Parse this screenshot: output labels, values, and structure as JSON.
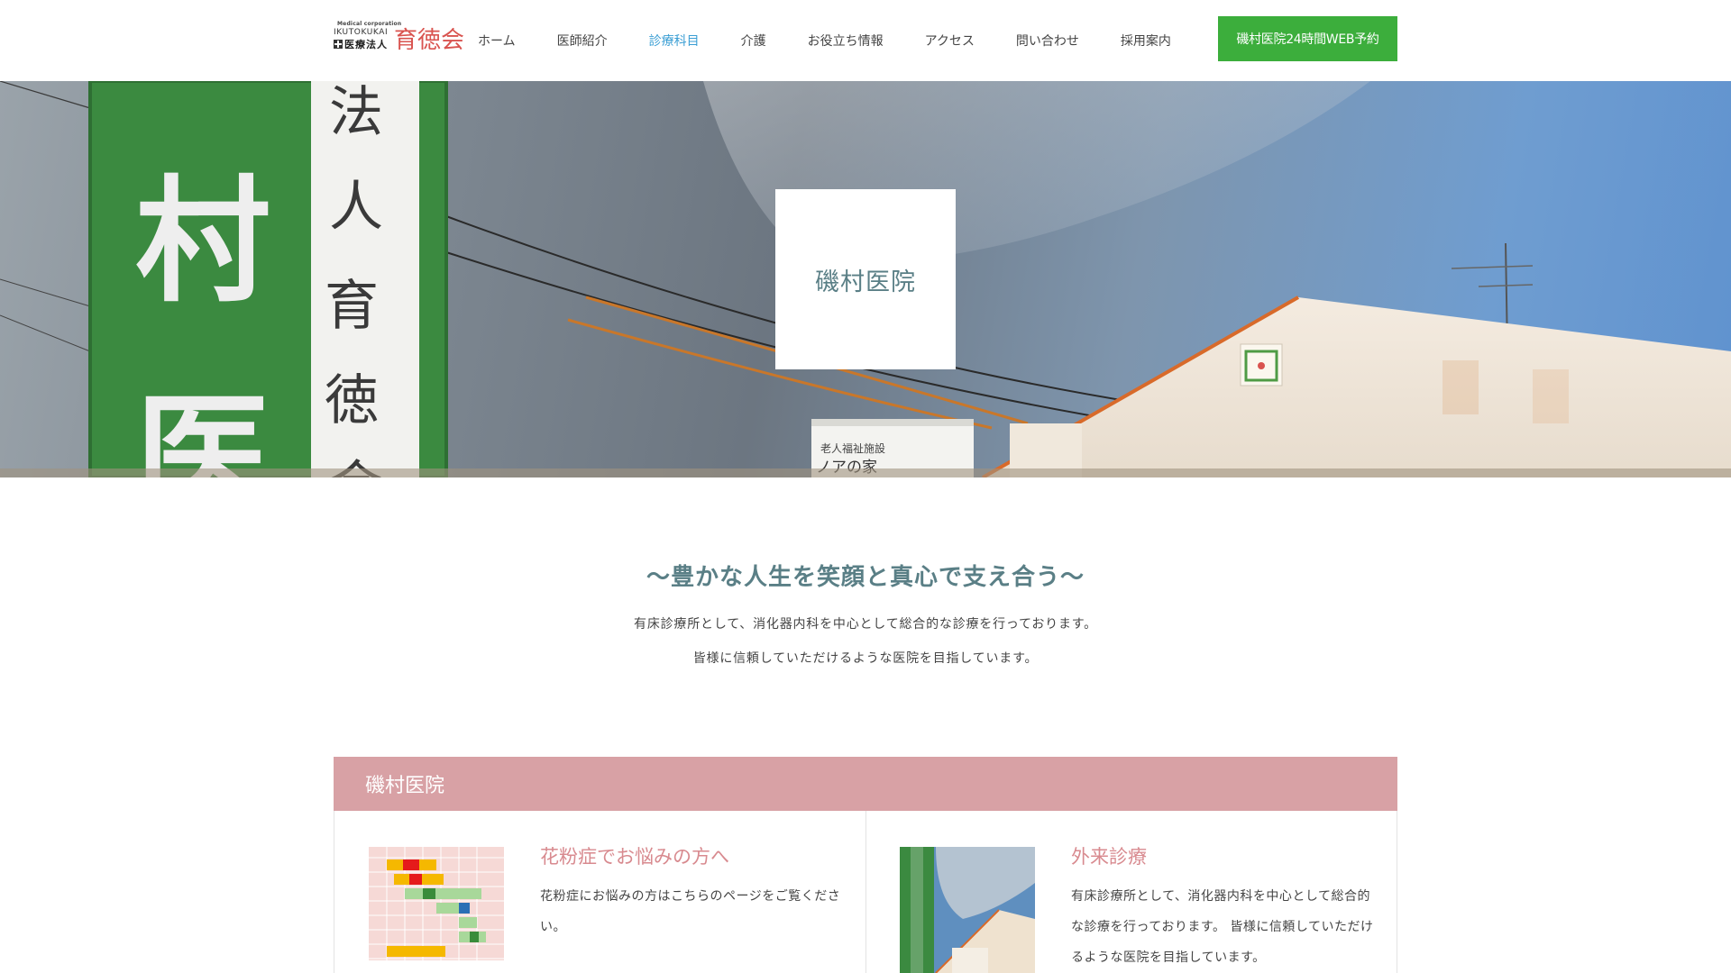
{
  "header": {
    "logo": {
      "en_line1": "Medical corporation",
      "en_line2": "IKUTOKUKAI",
      "jp_small": "医療法人",
      "jp_big": "育徳会"
    },
    "nav": [
      {
        "label": "ホーム"
      },
      {
        "label": "医師紹介"
      },
      {
        "label": "診療科目"
      },
      {
        "label": "介護"
      },
      {
        "label": "お役立ち情報"
      },
      {
        "label": "アクセス"
      },
      {
        "label": "問い合わせ"
      },
      {
        "label": "採用案内"
      }
    ],
    "active_nav_index": 2,
    "reserve_button": "磯村医院24時間WEB予約"
  },
  "hero": {
    "title": "磯村医院",
    "sign_text": [
      "法",
      "人",
      "育",
      "徳",
      "会"
    ],
    "sign_big_text": [
      "村",
      "医"
    ],
    "building_sign": "老人福祉施設",
    "building_name": "ノアの家"
  },
  "intro": {
    "catchphrase": "～豊かな人生を笑顔と真心で支え合う～",
    "line1": "有床診療所として、消化器内科を中心として総合的な診療を行っております。",
    "line2": "皆様に信頼していただけるような医院を目指しています。"
  },
  "section": {
    "heading": "磯村医院",
    "cards": [
      {
        "title": "花粉症でお悩みの方へ",
        "text": "花粉症にお悩みの方はこちらのページをご覧ください。"
      },
      {
        "title": "外来診療",
        "text": "有床診療所として、消化器内科を中心として総合的な診療を行っております。 皆様に信頼していただけるような医院を目指しています。"
      }
    ]
  },
  "colors": {
    "accent_green": "#3cae3c",
    "nav_active": "#3a9ed4",
    "section_header": "#d8a1a5",
    "card_title": "#d88a8f",
    "heading_teal": "#5a7f86"
  }
}
